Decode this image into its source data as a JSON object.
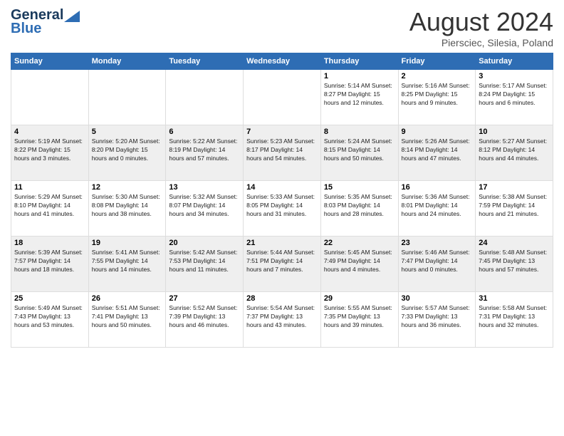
{
  "header": {
    "logo_general": "General",
    "logo_blue": "Blue",
    "month_title": "August 2024",
    "location": "Piersciec, Silesia, Poland"
  },
  "weekdays": [
    "Sunday",
    "Monday",
    "Tuesday",
    "Wednesday",
    "Thursday",
    "Friday",
    "Saturday"
  ],
  "weeks": [
    [
      {
        "day": "",
        "info": ""
      },
      {
        "day": "",
        "info": ""
      },
      {
        "day": "",
        "info": ""
      },
      {
        "day": "",
        "info": ""
      },
      {
        "day": "1",
        "info": "Sunrise: 5:14 AM\nSunset: 8:27 PM\nDaylight: 15 hours\nand 12 minutes."
      },
      {
        "day": "2",
        "info": "Sunrise: 5:16 AM\nSunset: 8:25 PM\nDaylight: 15 hours\nand 9 minutes."
      },
      {
        "day": "3",
        "info": "Sunrise: 5:17 AM\nSunset: 8:24 PM\nDaylight: 15 hours\nand 6 minutes."
      }
    ],
    [
      {
        "day": "4",
        "info": "Sunrise: 5:19 AM\nSunset: 8:22 PM\nDaylight: 15 hours\nand 3 minutes."
      },
      {
        "day": "5",
        "info": "Sunrise: 5:20 AM\nSunset: 8:20 PM\nDaylight: 15 hours\nand 0 minutes."
      },
      {
        "day": "6",
        "info": "Sunrise: 5:22 AM\nSunset: 8:19 PM\nDaylight: 14 hours\nand 57 minutes."
      },
      {
        "day": "7",
        "info": "Sunrise: 5:23 AM\nSunset: 8:17 PM\nDaylight: 14 hours\nand 54 minutes."
      },
      {
        "day": "8",
        "info": "Sunrise: 5:24 AM\nSunset: 8:15 PM\nDaylight: 14 hours\nand 50 minutes."
      },
      {
        "day": "9",
        "info": "Sunrise: 5:26 AM\nSunset: 8:14 PM\nDaylight: 14 hours\nand 47 minutes."
      },
      {
        "day": "10",
        "info": "Sunrise: 5:27 AM\nSunset: 8:12 PM\nDaylight: 14 hours\nand 44 minutes."
      }
    ],
    [
      {
        "day": "11",
        "info": "Sunrise: 5:29 AM\nSunset: 8:10 PM\nDaylight: 14 hours\nand 41 minutes."
      },
      {
        "day": "12",
        "info": "Sunrise: 5:30 AM\nSunset: 8:08 PM\nDaylight: 14 hours\nand 38 minutes."
      },
      {
        "day": "13",
        "info": "Sunrise: 5:32 AM\nSunset: 8:07 PM\nDaylight: 14 hours\nand 34 minutes."
      },
      {
        "day": "14",
        "info": "Sunrise: 5:33 AM\nSunset: 8:05 PM\nDaylight: 14 hours\nand 31 minutes."
      },
      {
        "day": "15",
        "info": "Sunrise: 5:35 AM\nSunset: 8:03 PM\nDaylight: 14 hours\nand 28 minutes."
      },
      {
        "day": "16",
        "info": "Sunrise: 5:36 AM\nSunset: 8:01 PM\nDaylight: 14 hours\nand 24 minutes."
      },
      {
        "day": "17",
        "info": "Sunrise: 5:38 AM\nSunset: 7:59 PM\nDaylight: 14 hours\nand 21 minutes."
      }
    ],
    [
      {
        "day": "18",
        "info": "Sunrise: 5:39 AM\nSunset: 7:57 PM\nDaylight: 14 hours\nand 18 minutes."
      },
      {
        "day": "19",
        "info": "Sunrise: 5:41 AM\nSunset: 7:55 PM\nDaylight: 14 hours\nand 14 minutes."
      },
      {
        "day": "20",
        "info": "Sunrise: 5:42 AM\nSunset: 7:53 PM\nDaylight: 14 hours\nand 11 minutes."
      },
      {
        "day": "21",
        "info": "Sunrise: 5:44 AM\nSunset: 7:51 PM\nDaylight: 14 hours\nand 7 minutes."
      },
      {
        "day": "22",
        "info": "Sunrise: 5:45 AM\nSunset: 7:49 PM\nDaylight: 14 hours\nand 4 minutes."
      },
      {
        "day": "23",
        "info": "Sunrise: 5:46 AM\nSunset: 7:47 PM\nDaylight: 14 hours\nand 0 minutes."
      },
      {
        "day": "24",
        "info": "Sunrise: 5:48 AM\nSunset: 7:45 PM\nDaylight: 13 hours\nand 57 minutes."
      }
    ],
    [
      {
        "day": "25",
        "info": "Sunrise: 5:49 AM\nSunset: 7:43 PM\nDaylight: 13 hours\nand 53 minutes."
      },
      {
        "day": "26",
        "info": "Sunrise: 5:51 AM\nSunset: 7:41 PM\nDaylight: 13 hours\nand 50 minutes."
      },
      {
        "day": "27",
        "info": "Sunrise: 5:52 AM\nSunset: 7:39 PM\nDaylight: 13 hours\nand 46 minutes."
      },
      {
        "day": "28",
        "info": "Sunrise: 5:54 AM\nSunset: 7:37 PM\nDaylight: 13 hours\nand 43 minutes."
      },
      {
        "day": "29",
        "info": "Sunrise: 5:55 AM\nSunset: 7:35 PM\nDaylight: 13 hours\nand 39 minutes."
      },
      {
        "day": "30",
        "info": "Sunrise: 5:57 AM\nSunset: 7:33 PM\nDaylight: 13 hours\nand 36 minutes."
      },
      {
        "day": "31",
        "info": "Sunrise: 5:58 AM\nSunset: 7:31 PM\nDaylight: 13 hours\nand 32 minutes."
      }
    ]
  ]
}
